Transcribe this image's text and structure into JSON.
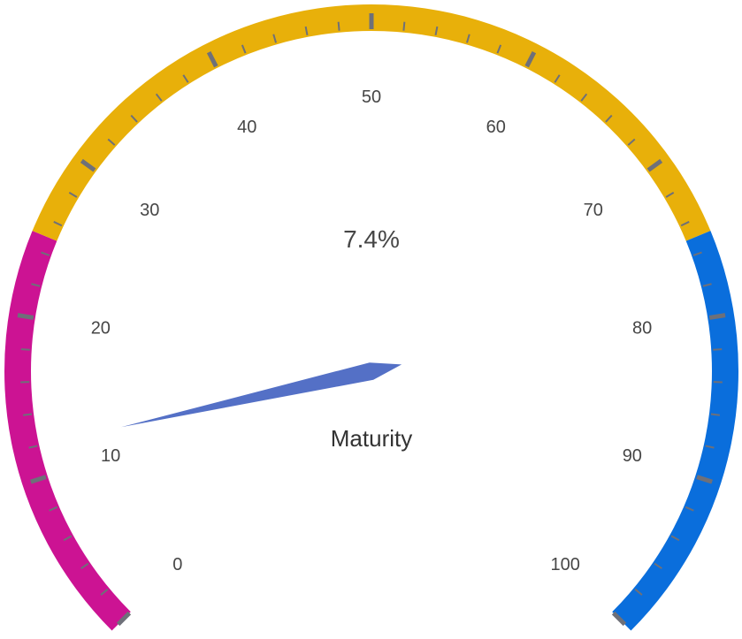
{
  "chart_data": {
    "type": "gauge",
    "min": 0,
    "max": 100,
    "value": 12,
    "detail": "7.4%",
    "name": "Maturity",
    "ticks": [
      "0",
      "10",
      "20",
      "30",
      "40",
      "50",
      "60",
      "70",
      "80",
      "90",
      "100"
    ],
    "bands": [
      {
        "to": 25,
        "color": "#CC1393"
      },
      {
        "to": 75,
        "color": "#E8B00A"
      },
      {
        "to": 100,
        "color": "#0A6EDC"
      }
    ],
    "pointer_color": "#5470C6",
    "tick_color": "#6E7079"
  }
}
